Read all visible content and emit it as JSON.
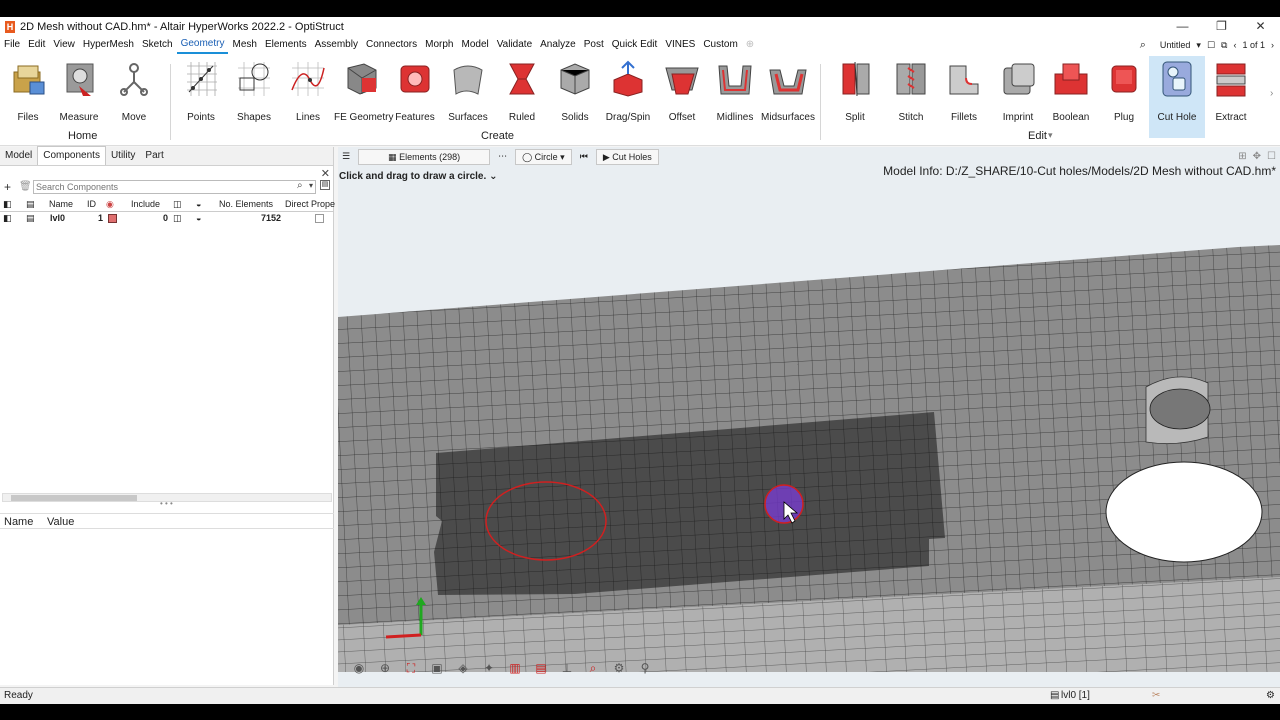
{
  "window": {
    "title": "2D Mesh without CAD.hm* - Altair HyperWorks 2022.2 - OptiStruct",
    "controls": [
      "—",
      "❐",
      "✕"
    ]
  },
  "menu": {
    "items": [
      "File",
      "Edit",
      "View",
      "HyperMesh",
      "Sketch",
      "Geometry",
      "Mesh",
      "Elements",
      "Assembly",
      "Connectors",
      "Morph",
      "Model",
      "Validate",
      "Analyze",
      "Post",
      "Quick Edit",
      "VINES",
      "Custom"
    ],
    "active": "Geometry",
    "session": "Untitled",
    "pager": "1 of 1"
  },
  "ribbon": {
    "home": {
      "label": "Home",
      "tools": [
        "Files",
        "Measure",
        "Move"
      ]
    },
    "create": {
      "label": "Create",
      "tools": [
        "Points",
        "Shapes",
        "Lines",
        "FE Geometry",
        "Features",
        "Surfaces",
        "Ruled",
        "Solids",
        "Drag/Spin",
        "Offset",
        "Midlines",
        "Midsurfaces"
      ]
    },
    "edit": {
      "label": "Edit",
      "tools": [
        "Split",
        "Stitch",
        "Fillets",
        "Imprint",
        "Boolean",
        "Plug",
        "Cut Hole",
        "Extract"
      ]
    }
  },
  "left_panel": {
    "tabs": [
      "Model",
      "Components",
      "Utility",
      "Part"
    ],
    "active_tab": "Components",
    "search_placeholder": "Search Components",
    "columns": [
      "Name",
      "ID",
      "Include",
      "No. Elements",
      "Direct Prope"
    ],
    "rows": [
      {
        "name": "lvl0",
        "id": "1",
        "include": "0",
        "elements": "7152",
        "color": "#e07070"
      }
    ],
    "properties_columns": [
      "Name",
      "Value"
    ]
  },
  "viewport": {
    "selector": "Elements (298)",
    "shape": "Circle",
    "action": "Cut Holes",
    "hint": "Click and drag to draw a circle.",
    "model_info": "Model Info: D:/Z_SHARE/10-Cut holes/Models/2D Mesh without CAD.hm*"
  },
  "status": {
    "text": "Ready",
    "component": "lvl0 [1]"
  },
  "colors": {
    "accent": "#1a8fd8",
    "mesh_light": "#8a8a8a",
    "mesh_selected": "#4a4a4a",
    "circle_red": "#d02020",
    "cursor_circle": "#7a3bd6"
  }
}
